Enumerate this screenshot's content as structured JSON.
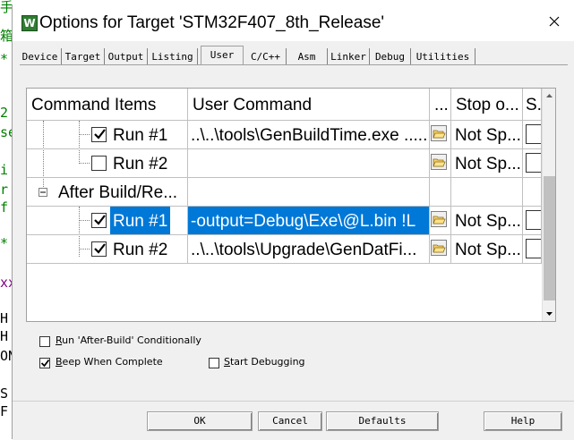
{
  "background": {
    "chars": [
      "手",
      "箱",
      "*",
      "2",
      "se",
      "i",
      "r",
      "f",
      "*",
      "xx",
      "H",
      "H",
      "ON",
      "S",
      "F"
    ]
  },
  "dialog": {
    "title": "Options for Target 'STM32F407_8th_Release'",
    "icon_letter": "W",
    "tabs": [
      "Device",
      "Target",
      "Output",
      "Listing",
      "User",
      "C/C++",
      "Asm",
      "Linker",
      "Debug",
      "Utilities"
    ],
    "active_tab": "User"
  },
  "grid": {
    "headers": [
      "Command Items",
      "User Command",
      "...",
      "Stop o...",
      "S."
    ],
    "group_label": "After Build/Re...",
    "rows": [
      {
        "label": "Run #1",
        "checked": true,
        "command": "..\\..\\tools\\GenBuildTime.exe .....",
        "stop": "Not Sp..."
      },
      {
        "label": "Run #2",
        "checked": false,
        "command": "",
        "stop": "Not Sp..."
      },
      {
        "label": "Run #1",
        "checked": true,
        "command": "-output=Debug\\Exe\\@L.bin !L",
        "stop": "Not Sp..."
      },
      {
        "label": "Run #2",
        "checked": true,
        "command": "..\\..\\tools\\Upgrade\\GenDatFi...",
        "stop": "Not Sp..."
      }
    ],
    "icons": [
      "browse-folder-icon",
      "collapse-minus-icon",
      "checkmark-icon"
    ]
  },
  "options": {
    "run_after_build_prefix": "R",
    "run_after_build_rest": "un 'After-Build' Conditionally",
    "run_after_build_checked": false,
    "beep_prefix": "B",
    "beep_rest": "eep When Complete",
    "beep_checked": true,
    "start_debug_prefix": "S",
    "start_debug_rest": "tart Debugging",
    "start_debug_checked": false
  },
  "buttons": {
    "ok": "OK",
    "cancel": "Cancel",
    "defaults": "Defaults",
    "help": "Help"
  },
  "colors": {
    "selection": "#0078d7",
    "dialog_bg": "#f0f0f0",
    "icon_green": "#2f7d32",
    "bg_code_green": "#008000",
    "bg_code_purple": "#7f007f"
  }
}
